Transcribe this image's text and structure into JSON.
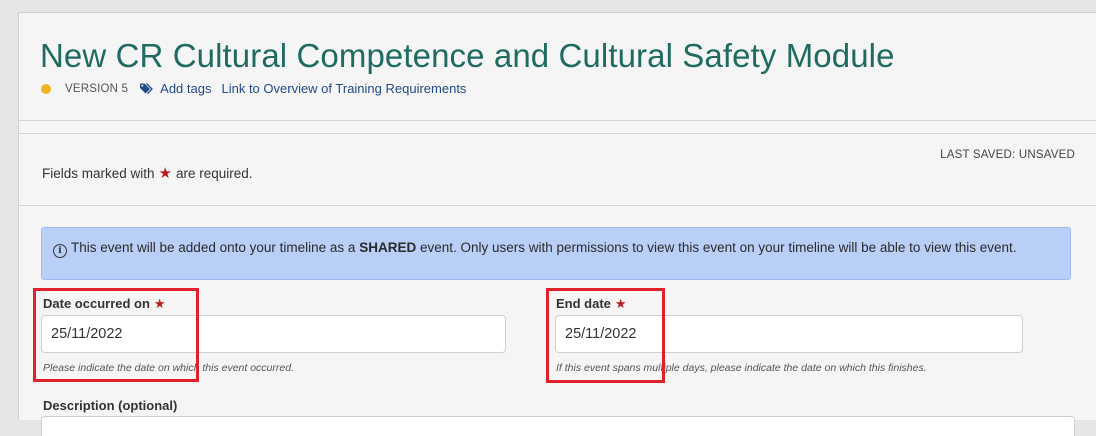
{
  "page": {
    "title": "New CR Cultural Competence and Cultural Safety Module",
    "version": "VERSION 5",
    "add_tags": "Add tags",
    "overview_link": "Link to Overview of Training Requirements",
    "status_color": "#f0b323",
    "status_icon": "status-dot-icon",
    "tag_icon": "tag-icon"
  },
  "form": {
    "required_prefix": "Fields marked with",
    "required_star": "★",
    "required_suffix": "are required.",
    "last_saved": "LAST SAVED: UNSAVED",
    "info": {
      "icon": "info-icon",
      "before": "This event will be added onto your timeline as a",
      "emphasis": "SHARED",
      "after": "event. Only users with permissions to view this event on your timeline will be able to view this event."
    },
    "date_occurred": {
      "label": "Date occurred on",
      "value": "25/11/2022",
      "help": "Please indicate the date on which this event occurred."
    },
    "end_date": {
      "label": "End date",
      "value": "25/11/2022",
      "help": "If this event spans multiple days, please indicate the date on which this finishes."
    },
    "description": {
      "label": "Description (optional)"
    }
  },
  "colors": {
    "title": "#1f6b62",
    "link": "#234a86",
    "info_bg": "#b9cff7",
    "required_star": "#b91c1c",
    "highlight": "#e0202a"
  }
}
